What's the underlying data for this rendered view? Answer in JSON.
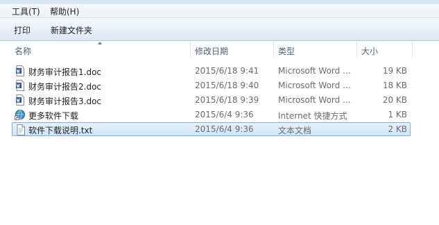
{
  "menubar": {
    "items": [
      {
        "label": "工具(T)"
      },
      {
        "label": "帮助(H)"
      }
    ]
  },
  "toolbar": {
    "buttons": [
      {
        "label": "打印"
      },
      {
        "label": "新建文件夹"
      }
    ]
  },
  "columns": {
    "name": "名称",
    "modified": "修改日期",
    "type": "类型",
    "size": "大小"
  },
  "files": [
    {
      "name": "财务审计报告1.doc",
      "modified": "2015/6/18 9:41",
      "type": "Microsoft Word ...",
      "size": "19 KB",
      "icon": "word-document-icon"
    },
    {
      "name": "财务审计报告2.doc",
      "modified": "2015/6/18 9:40",
      "type": "Microsoft Word ...",
      "size": "18 KB",
      "icon": "word-document-icon"
    },
    {
      "name": "财务审计报告3.doc",
      "modified": "2015/6/18 9:39",
      "type": "Microsoft Word ...",
      "size": "20 KB",
      "icon": "word-document-icon"
    },
    {
      "name": "更多软件下载",
      "modified": "2015/6/4 9:36",
      "type": "Internet 快捷方式",
      "size": "1 KB",
      "icon": "internet-shortcut-icon"
    },
    {
      "name": "软件下载说明.txt",
      "modified": "2015/6/4 9:36",
      "type": "文本文档",
      "size": "2 KB",
      "icon": "text-document-icon",
      "selected": true
    }
  ],
  "colors": {
    "selection_fill": "#d9e9fc",
    "selection_border": "#84acdd",
    "word_icon_blue": "#2b5797"
  }
}
